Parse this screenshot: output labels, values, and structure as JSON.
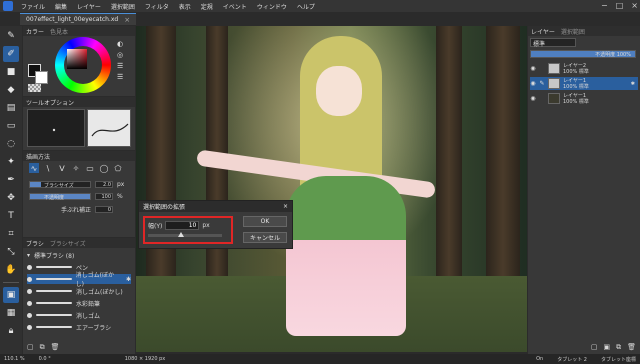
{
  "menu": [
    "ファイル",
    "編集",
    "レイヤー",
    "選択範囲",
    "フィルタ",
    "表示",
    "定規",
    "イベント",
    "ウィンドウ",
    "ヘルプ"
  ],
  "doc_tab": {
    "title": "007effect_light_00eyecatch.xd",
    "close": "×"
  },
  "color_panel": {
    "tab_active": "カラー",
    "tab_inactive": "色見本"
  },
  "tool_options": {
    "title": "ツールオプション"
  },
  "draw_method": {
    "title": "描画方法",
    "brush_size_label": "ブラシサイズ",
    "brush_size_value": "2.0",
    "brush_size_unit": "px",
    "opacity_label": "不透明度",
    "opacity_value": "100",
    "opacity_unit": "%",
    "hand_correction_label": "手ぶれ補正",
    "hand_correction_value": "0"
  },
  "brush_panel": {
    "tab_active": "ブラシ",
    "tab_inactive": "ブラシサイズ",
    "group": "標準ブラシ (8)",
    "items": [
      "ペン",
      "消しゴム(ぼかし)",
      "消しゴム(ぼかし)",
      "水彩鉛筆",
      "消しゴム",
      "エアーブラシ"
    ]
  },
  "dialog": {
    "title": "選択範囲の拡張",
    "width_label": "幅(Y)",
    "width_value": "10",
    "width_unit": "px",
    "ok": "OK",
    "cancel": "キャンセル"
  },
  "layer_panel": {
    "tab_active": "レイヤー",
    "tab_inactive": "選択範囲",
    "blend_mode": "標準",
    "opacity_text": "不透明度 100%",
    "layers": [
      {
        "name": "レイヤー2",
        "mode": "100% 標準"
      },
      {
        "name": "レイヤー1",
        "mode": "100% 標準"
      },
      {
        "name": "レイヤー1",
        "mode": "100% 標準"
      }
    ]
  },
  "status": {
    "zoom": "110.1 %",
    "angle": "0.0 °",
    "size": "1080 × 1920 px",
    "on": "On",
    "tablet1": "タブレット 2",
    "tablet2": "タブレット座標"
  },
  "colors": {
    "accent": "#2a5f9e",
    "highlight_border": "#e02626"
  }
}
